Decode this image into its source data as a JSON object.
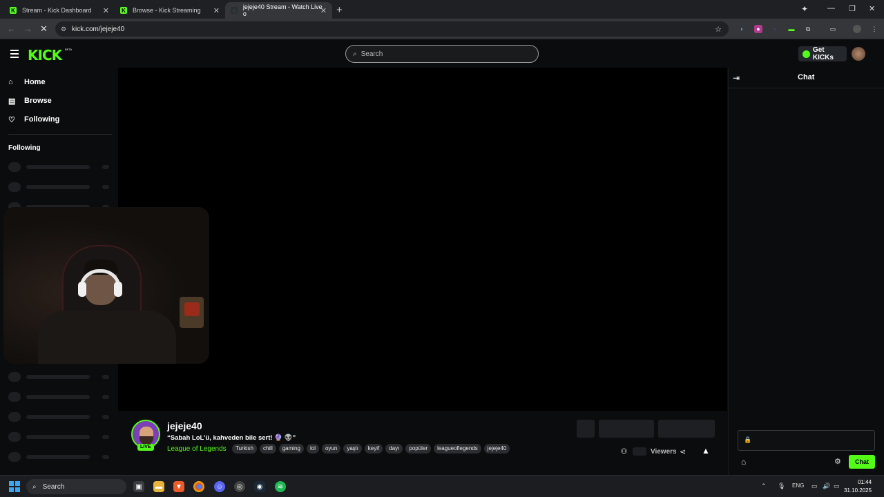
{
  "browser": {
    "tabs": [
      {
        "label": "Stream - Kick Dashboard"
      },
      {
        "label": "Browse - Kick Streaming"
      },
      {
        "label": "jejeje40 Stream - Watch Live o"
      }
    ],
    "url": "kick.com/jejeje40"
  },
  "header": {
    "logo": "KICK",
    "beta": "BETA",
    "search_placeholder": "Search",
    "get_kicks_label": "Get KICKs"
  },
  "sidebar": {
    "nav": [
      {
        "label": "Home",
        "icon": "home-icon"
      },
      {
        "label": "Browse",
        "icon": "browse-icon"
      },
      {
        "label": "Following",
        "icon": "heart-icon"
      }
    ],
    "following_label": "Following"
  },
  "channel": {
    "name": "jejeje40",
    "live_label": "LIVE",
    "title": "“Sabah LoL’ü, kahveden bile sert! 🔮 👽”",
    "category": "League of Legends",
    "tags": [
      "Turkish",
      "chill",
      "gaming",
      "lol",
      "oyun",
      "yaşlı",
      "keyif",
      "dayı",
      "popüler",
      "leagueoflegends",
      "jejeje40"
    ],
    "viewers_label": "Viewers"
  },
  "chat": {
    "title": "Chat",
    "send_label": "Chat"
  },
  "taskbar": {
    "search_label": "Search",
    "language": "ENG",
    "time": "01:44",
    "date": "31.10.2025"
  },
  "colors": {
    "brand": "#53fc18",
    "background": "#0b0c0d"
  }
}
